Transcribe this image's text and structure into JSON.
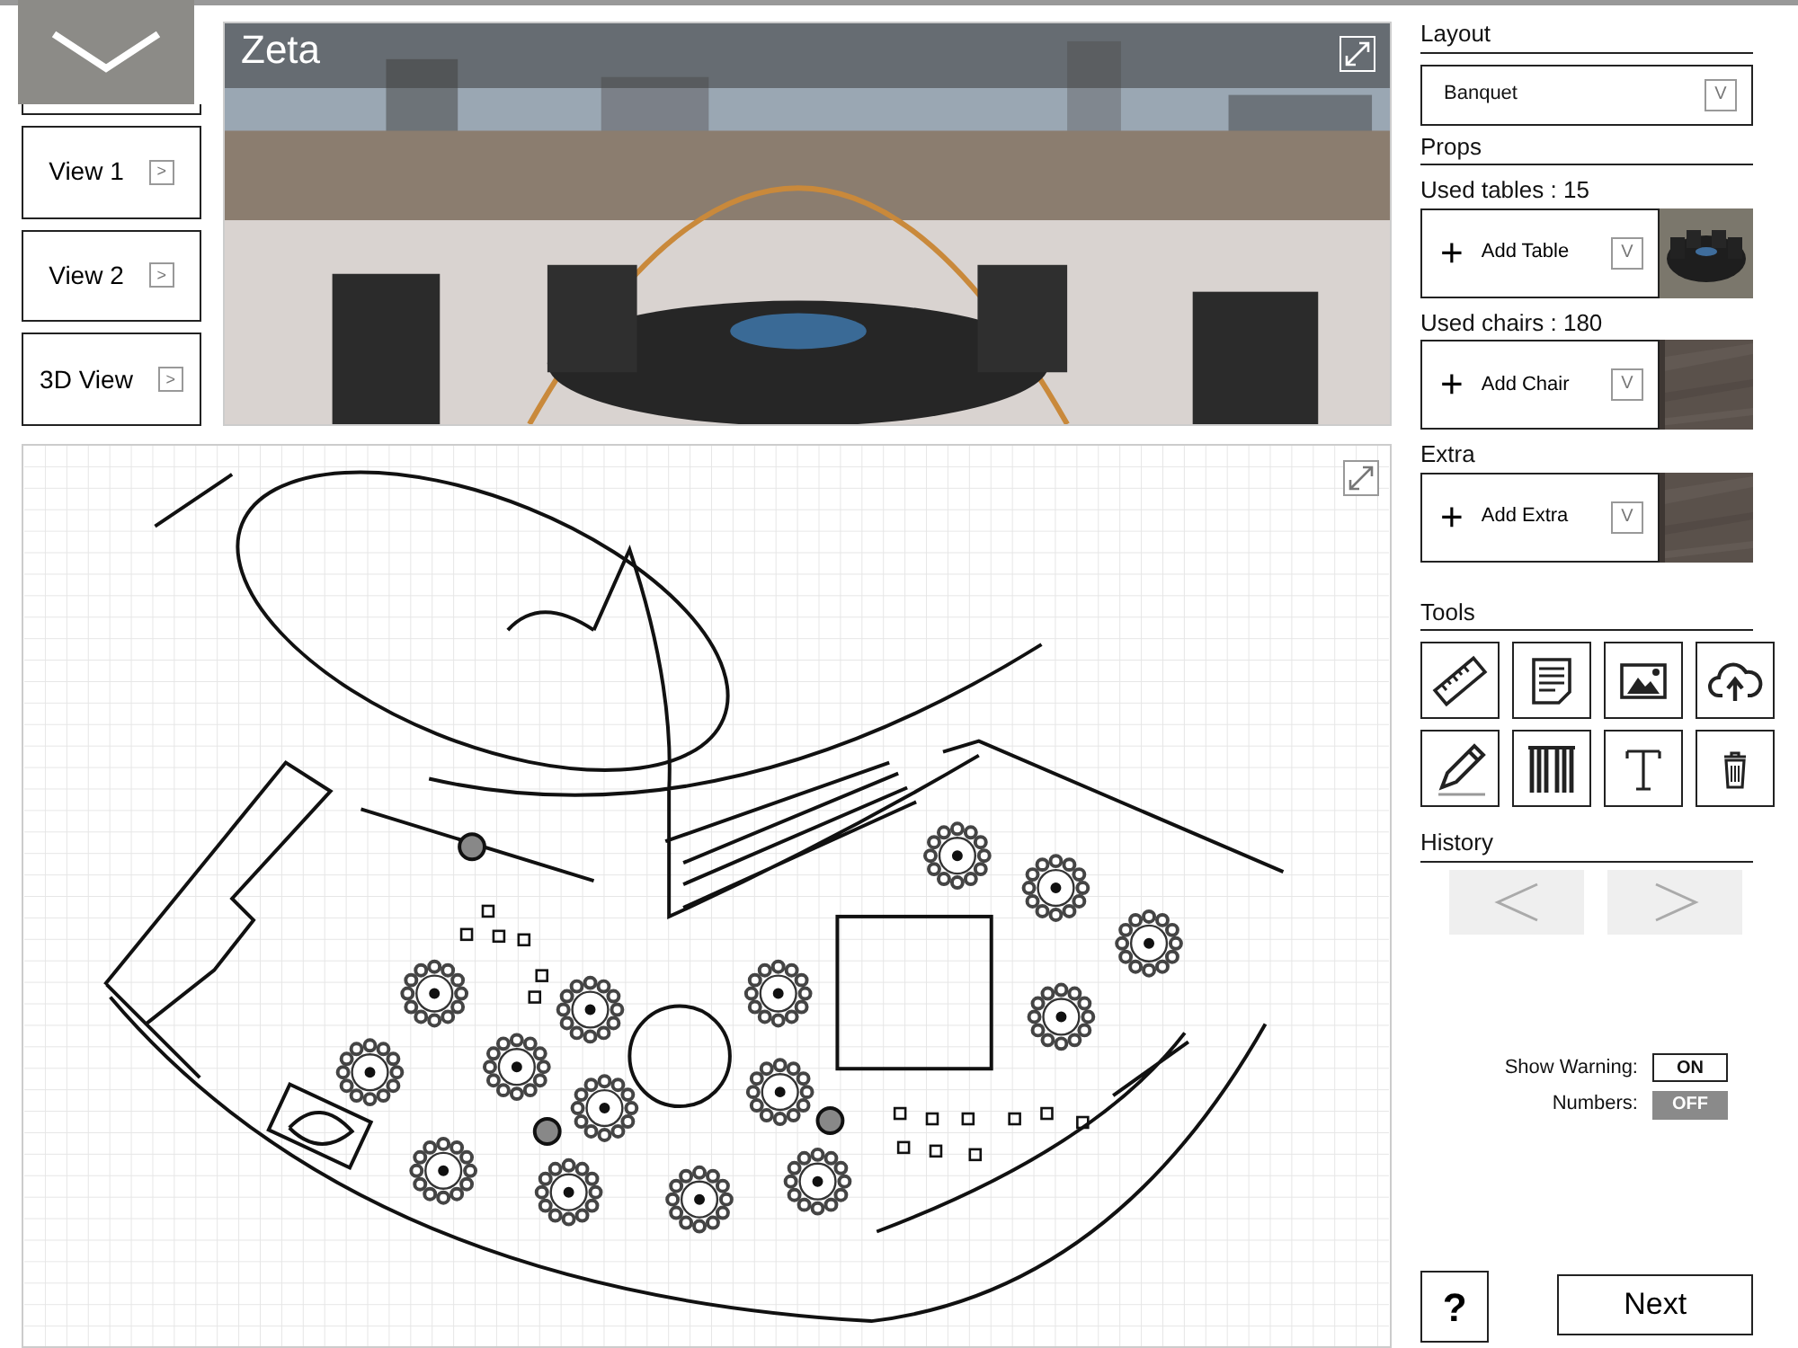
{
  "views": [
    {
      "label": "View 1",
      "arrow": ">"
    },
    {
      "label": "View 2",
      "arrow": ">"
    },
    {
      "label": "3D View",
      "arrow": ">"
    }
  ],
  "preview": {
    "title": "Zeta"
  },
  "layout": {
    "heading": "Layout",
    "value": "Banquet",
    "caret": "V"
  },
  "props": {
    "heading": "Props",
    "items": [
      {
        "label": "Used tables : 15",
        "button": "Add Table",
        "plus": "+",
        "caret": "V"
      },
      {
        "label": "Used chairs : 180",
        "button": "Add Chair",
        "plus": "+",
        "caret": "V"
      },
      {
        "label": "Extra",
        "button": "Add Extra",
        "plus": "+",
        "caret": "V"
      }
    ]
  },
  "tools": {
    "heading": "Tools"
  },
  "history": {
    "heading": "History"
  },
  "toggles": [
    {
      "label": "Show Warning:",
      "on": true,
      "on_text": "ON"
    },
    {
      "label": "Numbers:",
      "on": false,
      "on_text": "OFF"
    }
  ],
  "help": {
    "label": "?"
  },
  "next": {
    "label": "Next"
  }
}
